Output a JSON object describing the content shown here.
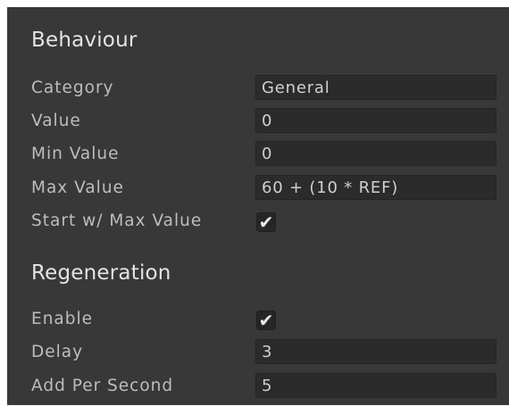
{
  "behaviour": {
    "title": "Behaviour",
    "category": {
      "label": "Category",
      "value": "General"
    },
    "value": {
      "label": "Value",
      "value": "0"
    },
    "min_value": {
      "label": "Min Value",
      "value": "0"
    },
    "max_value": {
      "label": "Max Value",
      "value": "60 + (10 * REF)"
    },
    "start_max": {
      "label": "Start w/ Max Value",
      "checked": true
    }
  },
  "regeneration": {
    "title": "Regeneration",
    "enable": {
      "label": "Enable",
      "checked": true
    },
    "delay": {
      "label": "Delay",
      "value": "3"
    },
    "add_per_second": {
      "label": "Add Per Second",
      "value": "5"
    }
  },
  "icons": {
    "checkmark": "checkmark-icon"
  }
}
